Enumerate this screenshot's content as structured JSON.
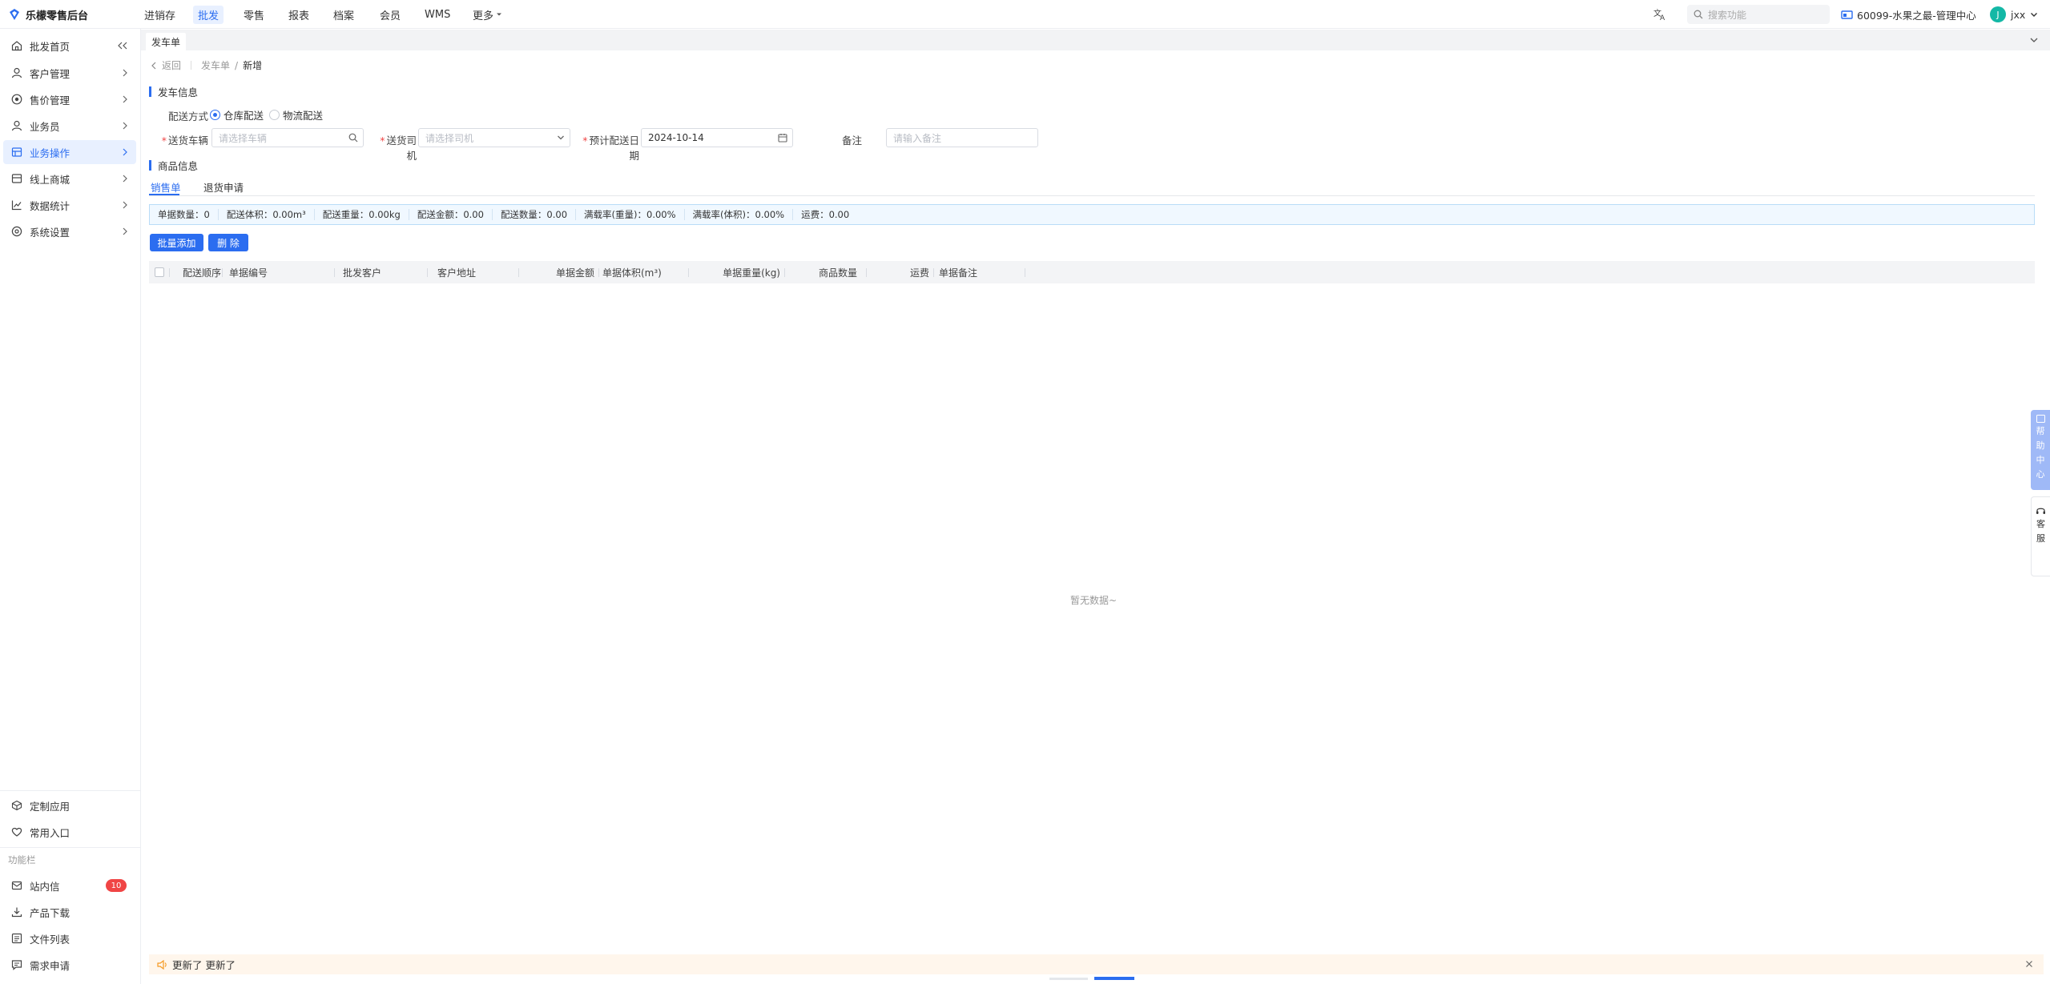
{
  "app": {
    "title": "乐檬零售后台"
  },
  "topnav": [
    {
      "label": "进销存"
    },
    {
      "label": "批发"
    },
    {
      "label": "零售"
    },
    {
      "label": "报表"
    },
    {
      "label": "档案"
    },
    {
      "label": "会员"
    },
    {
      "label": "WMS"
    },
    {
      "label": "更多"
    }
  ],
  "header": {
    "search_placeholder": "搜索功能",
    "store": "60099-水果之最-管理中心",
    "user_initial": "J",
    "user_name": "jxx"
  },
  "sidebar": {
    "items": [
      {
        "label": "批发首页"
      },
      {
        "label": "客户管理"
      },
      {
        "label": "售价管理"
      },
      {
        "label": "业务员"
      },
      {
        "label": "业务操作"
      },
      {
        "label": "线上商城"
      },
      {
        "label": "数据统计"
      },
      {
        "label": "系统设置"
      }
    ],
    "bottom": [
      {
        "label": "定制应用"
      },
      {
        "label": "常用入口"
      }
    ],
    "func_title": "功能栏",
    "func": [
      {
        "label": "站内信",
        "badge": "10"
      },
      {
        "label": "产品下载"
      },
      {
        "label": "文件列表"
      },
      {
        "label": "需求申请"
      }
    ]
  },
  "tabs": {
    "active": "发车单"
  },
  "breadcrumb": {
    "back": "返回",
    "parent": "发车单",
    "sep": "/",
    "current": "新增"
  },
  "dispatch": {
    "title": "发车信息",
    "method_label": "配送方式",
    "method_options": [
      "仓库配送",
      "物流配送"
    ],
    "vehicle_label": "送货车辆",
    "vehicle_placeholder": "请选择车辆",
    "driver_label": "送货司机",
    "driver_placeholder": "请选择司机",
    "date_label": "预计配送日期",
    "date_value": "2024-10-14",
    "note_label": "备注",
    "note_placeholder": "请输入备注"
  },
  "goods": {
    "title": "商品信息",
    "tabs": [
      "销售单",
      "退货申请"
    ],
    "summary": [
      "单据数量：0",
      "配送体积：0.00m³",
      "配送重量：0.00kg",
      "配送金额：0.00",
      "配送数量：0.00",
      "满载率(重量)：0.00%",
      "满载率(体积)：0.00%",
      "运费：0.00"
    ],
    "btn_batch_add": "批量添加",
    "btn_delete": "删 除",
    "columns": [
      "配送顺序",
      "单据编号",
      "批发客户",
      "客户地址",
      "单据金额",
      "单据体积(m³)",
      "单据重量(kg)",
      "商品数量",
      "运费",
      "单据备注"
    ],
    "empty": "暂无数据~"
  },
  "notice": {
    "text": "更新了 更新了"
  },
  "float": {
    "help": [
      "帮",
      "助",
      "中",
      "心"
    ],
    "cs": [
      "客",
      "服"
    ]
  },
  "colors": {
    "accent": "#2b6df0",
    "badge": "#f04545",
    "notice_bg": "#fff6ec",
    "summary_bg": "#f0f8ff"
  }
}
